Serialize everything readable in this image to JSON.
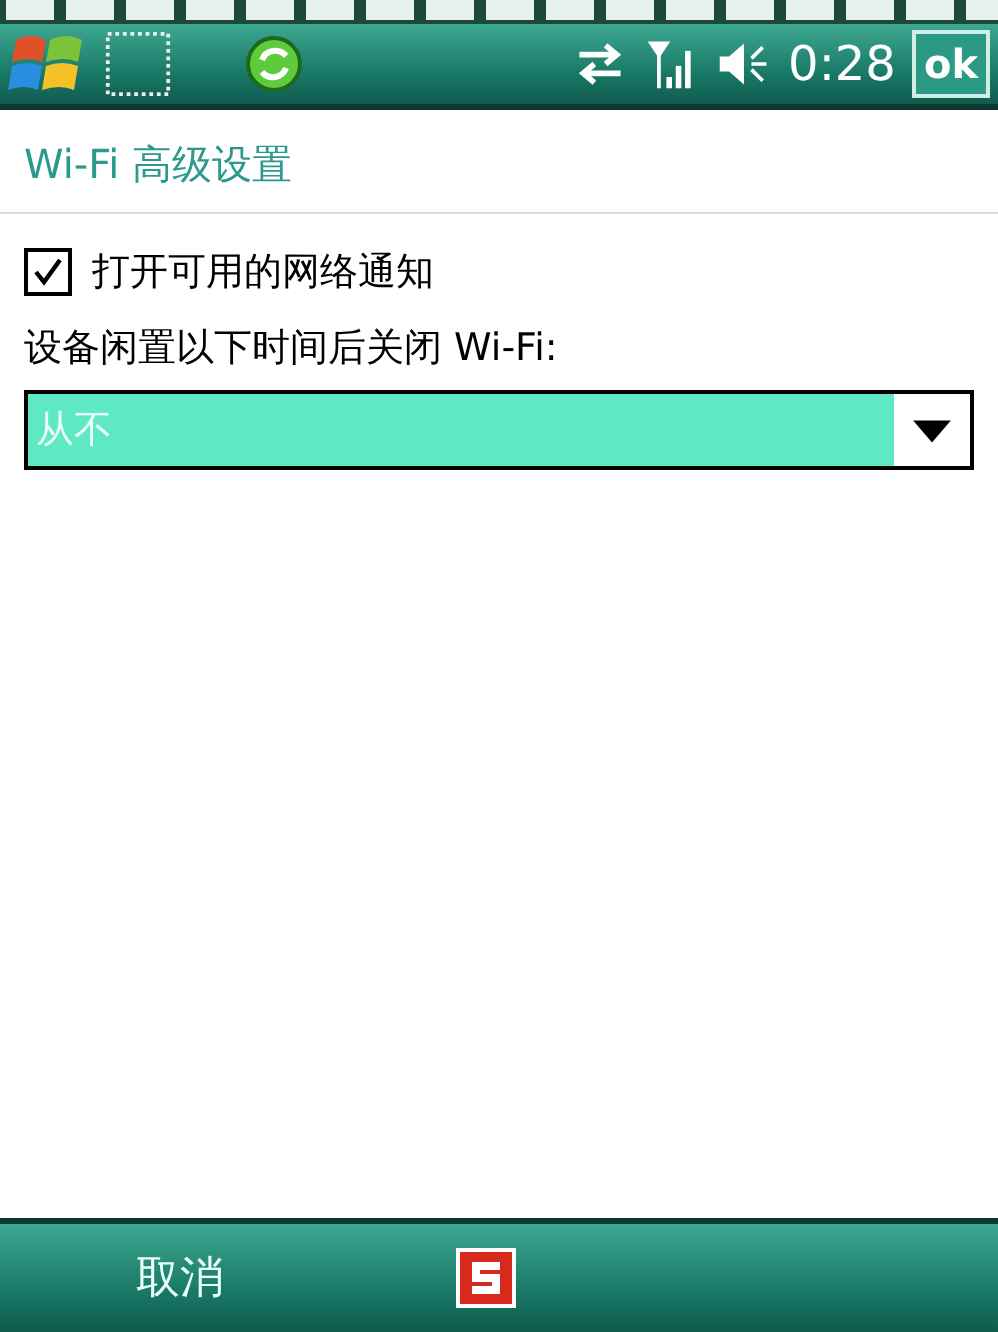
{
  "status_bar": {
    "time": "0:28",
    "ok_button": "ok"
  },
  "title": "Wi-Fi 高级设置",
  "notify_checkbox": {
    "label": "打开可用的网络通知",
    "checked": true
  },
  "timeout_setting": {
    "label": "设备闲置以下时间后关闭 Wi-Fi:",
    "value": "从不"
  },
  "soft_keys": {
    "left": "取消"
  }
}
